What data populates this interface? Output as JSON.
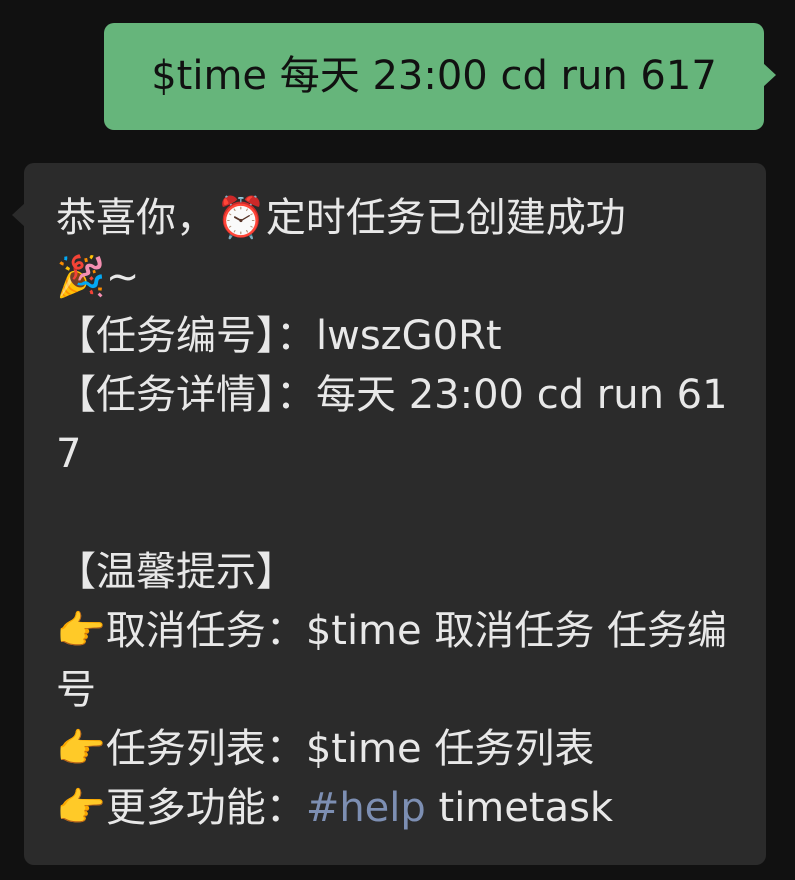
{
  "messages": {
    "outgoing": {
      "text": "$time 每天 23:00 cd run 617"
    },
    "incoming": {
      "greeting": "恭喜你，",
      "alarm_emoji": "⏰",
      "created_text": "定时任务已创建成功",
      "party_emoji": "🎉",
      "tilde": "~",
      "task_id_label": "【任务编号】：",
      "task_id_value": "lwszG0Rt",
      "task_detail_label": "【任务详情】：",
      "task_detail_value": "每天 23:00 cd run 617",
      "tips_header": "【温馨提示】",
      "pointer_emoji": "👉",
      "cancel_label": "取消任务：",
      "cancel_command": "$time 取消任务 任务编号",
      "list_label": "任务列表：",
      "list_command": "$time 任务列表",
      "more_label": "更多功能：",
      "more_tag": "#help",
      "more_command": " timetask"
    }
  },
  "colors": {
    "background": "#111111",
    "outgoing_bubble": "#66b57b",
    "incoming_bubble": "#2b2b2b",
    "incoming_text": "#e8e8e8",
    "link": "#7d8fb3"
  }
}
